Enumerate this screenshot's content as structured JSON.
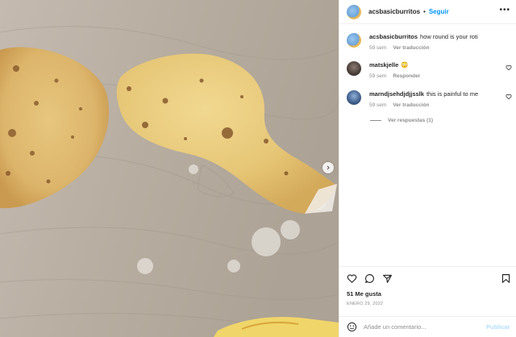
{
  "post": {
    "author": "acsbasicburritos",
    "separator": "•",
    "follow_label": "Seguir",
    "more_label": "•••"
  },
  "caption": {
    "user": "acsbasicburritos",
    "text": "how round is your roti",
    "time": "59 sem",
    "translate": "Ver traducción"
  },
  "comments": [
    {
      "user": "matskjelle",
      "text": "😳",
      "time": "59 sem",
      "action": "Responder"
    },
    {
      "user": "marndjsehdjdjjsslk",
      "text": "this is painful to me",
      "time": "59 sem",
      "action": "Ver traducción"
    }
  ],
  "replies_label": "Ver respuestas (1)",
  "likes_text": "51 Me gusta",
  "date_text": "ENERO 29, 2022",
  "composer": {
    "placeholder": "Añade un comentario...",
    "publish_label": "Publicar"
  },
  "colors": {
    "link": "#0095f6",
    "muted": "#8e8e8e",
    "publish_disabled": "#b2dffc"
  },
  "icons": [
    "heart-icon",
    "comment-icon",
    "share-icon",
    "bookmark-icon",
    "emoji-icon",
    "chevron-right-icon",
    "more-icon"
  ]
}
